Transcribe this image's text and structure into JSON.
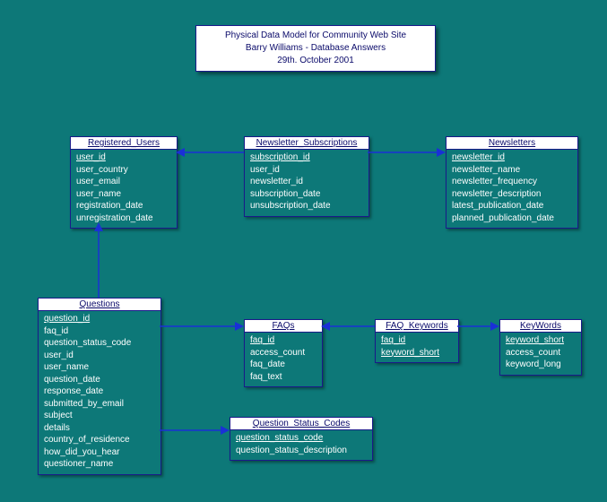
{
  "title": {
    "line1": "Physical Data Model for Community Web Site",
    "line2": "Barry Williams - Database Answers",
    "line3": "29th. October 2001"
  },
  "entities": {
    "registered_users": {
      "name": "Registered_Users",
      "pk": "user_id",
      "fields": [
        "user_country",
        "user_email",
        "user_name",
        "registration_date",
        "unregistration_date"
      ]
    },
    "newsletter_subscriptions": {
      "name": "Newsletter_Subscriptions",
      "pk": "subscription_id",
      "fields": [
        "user_id",
        "newsletter_id",
        "subscription_date",
        "unsubscription_date"
      ]
    },
    "newsletters": {
      "name": "Newsletters",
      "pk": "newsletter_id",
      "fields": [
        "newsletter_name",
        "newsletter_frequency",
        "newsletter_description",
        "latest_publication_date",
        "planned_publication_date"
      ]
    },
    "questions": {
      "name": "Questions",
      "pk": "question_id",
      "fields": [
        "faq_id",
        "question_status_code",
        "user_id",
        "user_name",
        "question_date",
        "response_date",
        "submitted_by_email",
        "subject",
        "details",
        "country_of_residence",
        "how_did_you_hear",
        "questioner_name"
      ]
    },
    "faqs": {
      "name": "FAQs",
      "pk": "faq_id",
      "fields": [
        "access_count",
        "faq_date",
        "faq_text"
      ]
    },
    "faq_keywords": {
      "name": "FAQ_Keywords",
      "pk": "faq_id",
      "fields_pk2": "keyword_short"
    },
    "keywords": {
      "name": "KeyWords",
      "pk": "keyword_short",
      "fields": [
        "access_count",
        "keyword_long"
      ]
    },
    "question_status_codes": {
      "name": "Question_Status_Codes",
      "pk": "question_status_code",
      "fields": [
        "question_status_description"
      ]
    }
  }
}
